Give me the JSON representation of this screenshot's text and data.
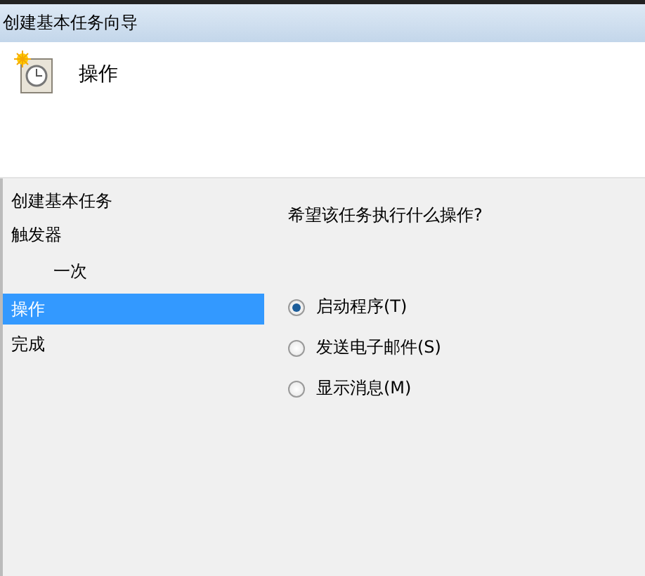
{
  "window": {
    "title": "创建基本任务向导"
  },
  "header": {
    "title": "操作"
  },
  "sidebar": {
    "items": [
      {
        "label": "创建基本任务",
        "selected": false
      },
      {
        "label": "触发器",
        "selected": false,
        "children": [
          {
            "label": "一次",
            "selected": false
          }
        ]
      },
      {
        "label": "操作",
        "selected": true
      },
      {
        "label": "完成",
        "selected": false
      }
    ]
  },
  "content": {
    "question": "希望该任务执行什么操作?",
    "options": [
      {
        "label": "启动程序(T)",
        "selected": true
      },
      {
        "label": "发送电子邮件(S)",
        "selected": false
      },
      {
        "label": "显示消息(M)",
        "selected": false
      }
    ]
  }
}
